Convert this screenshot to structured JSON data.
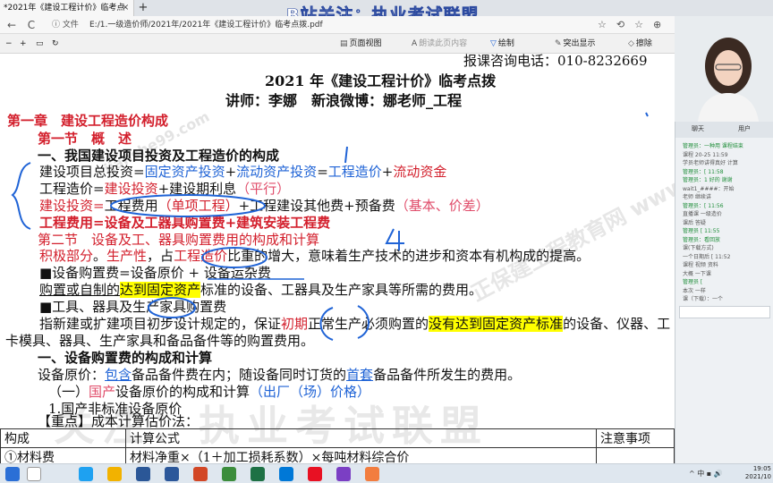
{
  "browser": {
    "tab_title": "*2021年《建设工程计价》临考点",
    "tab_close": "×",
    "new_tab": "+",
    "back": "←",
    "reload": "C",
    "url_info": "ⓘ 文件",
    "url": "E:/1.一级造价师/2021年/2021年《建设工程计价》临考点拨.pdf"
  },
  "banner": "B站关注：执业考试联盟",
  "toolbar": {
    "page_view": "页面视图",
    "read_aloud": "朗读此页内容",
    "draw": "绘制",
    "highlight": "突出显示",
    "erase": "擦除"
  },
  "doc": {
    "phone": "报课咨询电话：010-8232669",
    "title": "2021 年《建设工程计价》临考点拨",
    "lecturer": "讲师：李娜　新浪微博：娜老师_工程",
    "chapter": "第一章　建设工程造价构成",
    "section1": "第一节　概　述",
    "heading1": "一、我国建设项目投资及工程造价的构成",
    "l_total_a": "建设项目总投资=",
    "l_total_b": "固定资产投资",
    "l_total_c": "+",
    "l_total_d": "流动资产投资",
    "l_total_e": "=",
    "l_total_f": "工程造价",
    "l_total_g": "+",
    "l_total_h": "流动资金",
    "l_cost_a": "工程造价=",
    "l_cost_b": "建设投资",
    "l_cost_c": "+建设期利息",
    "l_cost_d": "（平行）",
    "l_inv_a": "建设投资=",
    "l_inv_b": "工程费用",
    "l_inv_c": "（单项工程）",
    "l_inv_d": "+工程建设其他费+预备费",
    "l_inv_e": "（基本、价差）",
    "l_eng": "工程费用=设备及工器具购置费+建筑安装工程费",
    "section2": "第二节　设备及工、器具购置费用的构成和计算",
    "l_pos_a": "积极部分",
    "l_pos_b": "。",
    "l_pos_c": "生产性",
    "l_pos_d": "，占",
    "l_pos_e": "工程造价",
    "l_pos_f": "比重的增大，意味着生产技术的进步和资本有机构成的提高。",
    "l_equip_fee": "■设备购置费=设备原价 + 设备运杂费",
    "l_purchase_a": "购置或自制的",
    "l_purchase_b": "达到固定资产",
    "l_purchase_c": "标准的设备、工器具及生产家具等所需的费用。",
    "l_tools": "■工具、器具及生产家具购置费",
    "l_new_a": "指新建或扩建项目初步设计规定的，保证",
    "l_new_b": "初期",
    "l_new_c": "正常生产必须购置的",
    "l_new_d": "没有达到固定资产标准",
    "l_new_e": "的设备、仪器、工",
    "l_mold": "卡模具、器具、生产家具和备品备件等的购置费用。",
    "heading2": "一、设备购置费的构成和计算",
    "l_orig_a": "设备原价：",
    "l_orig_b": "包含",
    "l_orig_c": "备品备件费在内；随设备同时订货的",
    "l_orig_d": "首套",
    "l_orig_e": "备品备件所发生的费用。",
    "l_dom_a": "（一）",
    "l_dom_b": "国产",
    "l_dom_c": "设备原价的构成和计算",
    "l_dom_d": "（出厂（场）价格）",
    "l_nonstd": "1.国产非标准设备原价",
    "l_key": "【重点】成本计算估价法：",
    "table_headers": [
      "构成",
      "计算公式",
      "注意事项"
    ],
    "table_row1": [
      "①材料费",
      "材料净重×（1＋加工损耗系数）×每吨材料综合价",
      ""
    ],
    "watermark": "关注：执业考试联盟",
    "wm_site1": "正保建工程教育网 www.jianshe99.com",
    "wm_site2": "jianshe99.com"
  },
  "chat": {
    "tab1": "聊天",
    "tab2": "用户",
    "messages": [
      "管理员：一种用 课程结束",
      "课程 20-25 11:59",
      "学员老师讲得真好 计算",
      "管理员：[ 11:58",
      "管理员：1 好的 谢谢",
      "wait1_####：开始",
      "老师 继续讲",
      "管理员：[ 11:56",
      "直播课 一级造价",
      "课后 答疑",
      "管理员 [ 11:55",
      "管理员：看回放",
      "课(下载方式)",
      "一个日期后 [ 11:52",
      "课程 视频 资料",
      "大概 一下课",
      "管理员 [",
      "本次 一样",
      "课（下载）：一个"
    ]
  },
  "taskbar": {
    "tray": "^ 中 ▪ 🔊",
    "time": "19:05",
    "date": "2021/10"
  },
  "colors": {
    "red": "#d3202d",
    "blue": "#1f63d6",
    "highlight": "#ffff00",
    "banner_stroke": "#2c4aa0"
  }
}
